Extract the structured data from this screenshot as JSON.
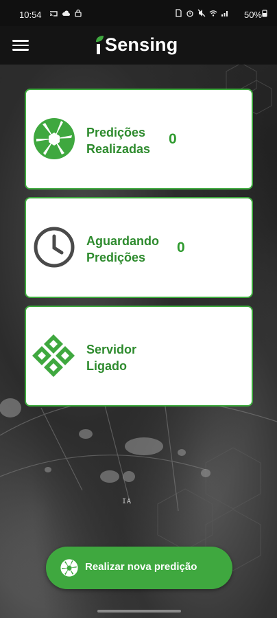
{
  "status_bar": {
    "time": "10:54",
    "battery": "50%",
    "left_icons": [
      "cast-icon",
      "cloud-icon",
      "lock-icon"
    ],
    "right_icons": [
      "sim-icon",
      "alarm-icon",
      "mute-icon",
      "wifi-icon",
      "signal-icon",
      "battery-icon"
    ]
  },
  "app_bar": {
    "menu_icon": "hamburger-menu-icon",
    "brand": "Sensing",
    "brand_prefix_icon": "leaf-i-icon"
  },
  "cards": [
    {
      "label_line1": "Predições",
      "label_line2": "Realizadas",
      "count": "0",
      "icon": "camera-shutter-icon"
    },
    {
      "label_line1": "Aguardando",
      "label_line2": "Predições",
      "count": "0",
      "icon": "clock-icon"
    },
    {
      "label_line1": "Servidor",
      "label_line2": "Ligado",
      "icon": "server-diamond-icon"
    }
  ],
  "background_text": "IA",
  "fab": {
    "label": "Realizar nova predição",
    "icon": "camera-shutter-icon"
  },
  "colors": {
    "accent": "#3fa83f",
    "card_border": "#3daa3d",
    "text_green": "#2e8b2e",
    "app_bar": "#141414"
  }
}
